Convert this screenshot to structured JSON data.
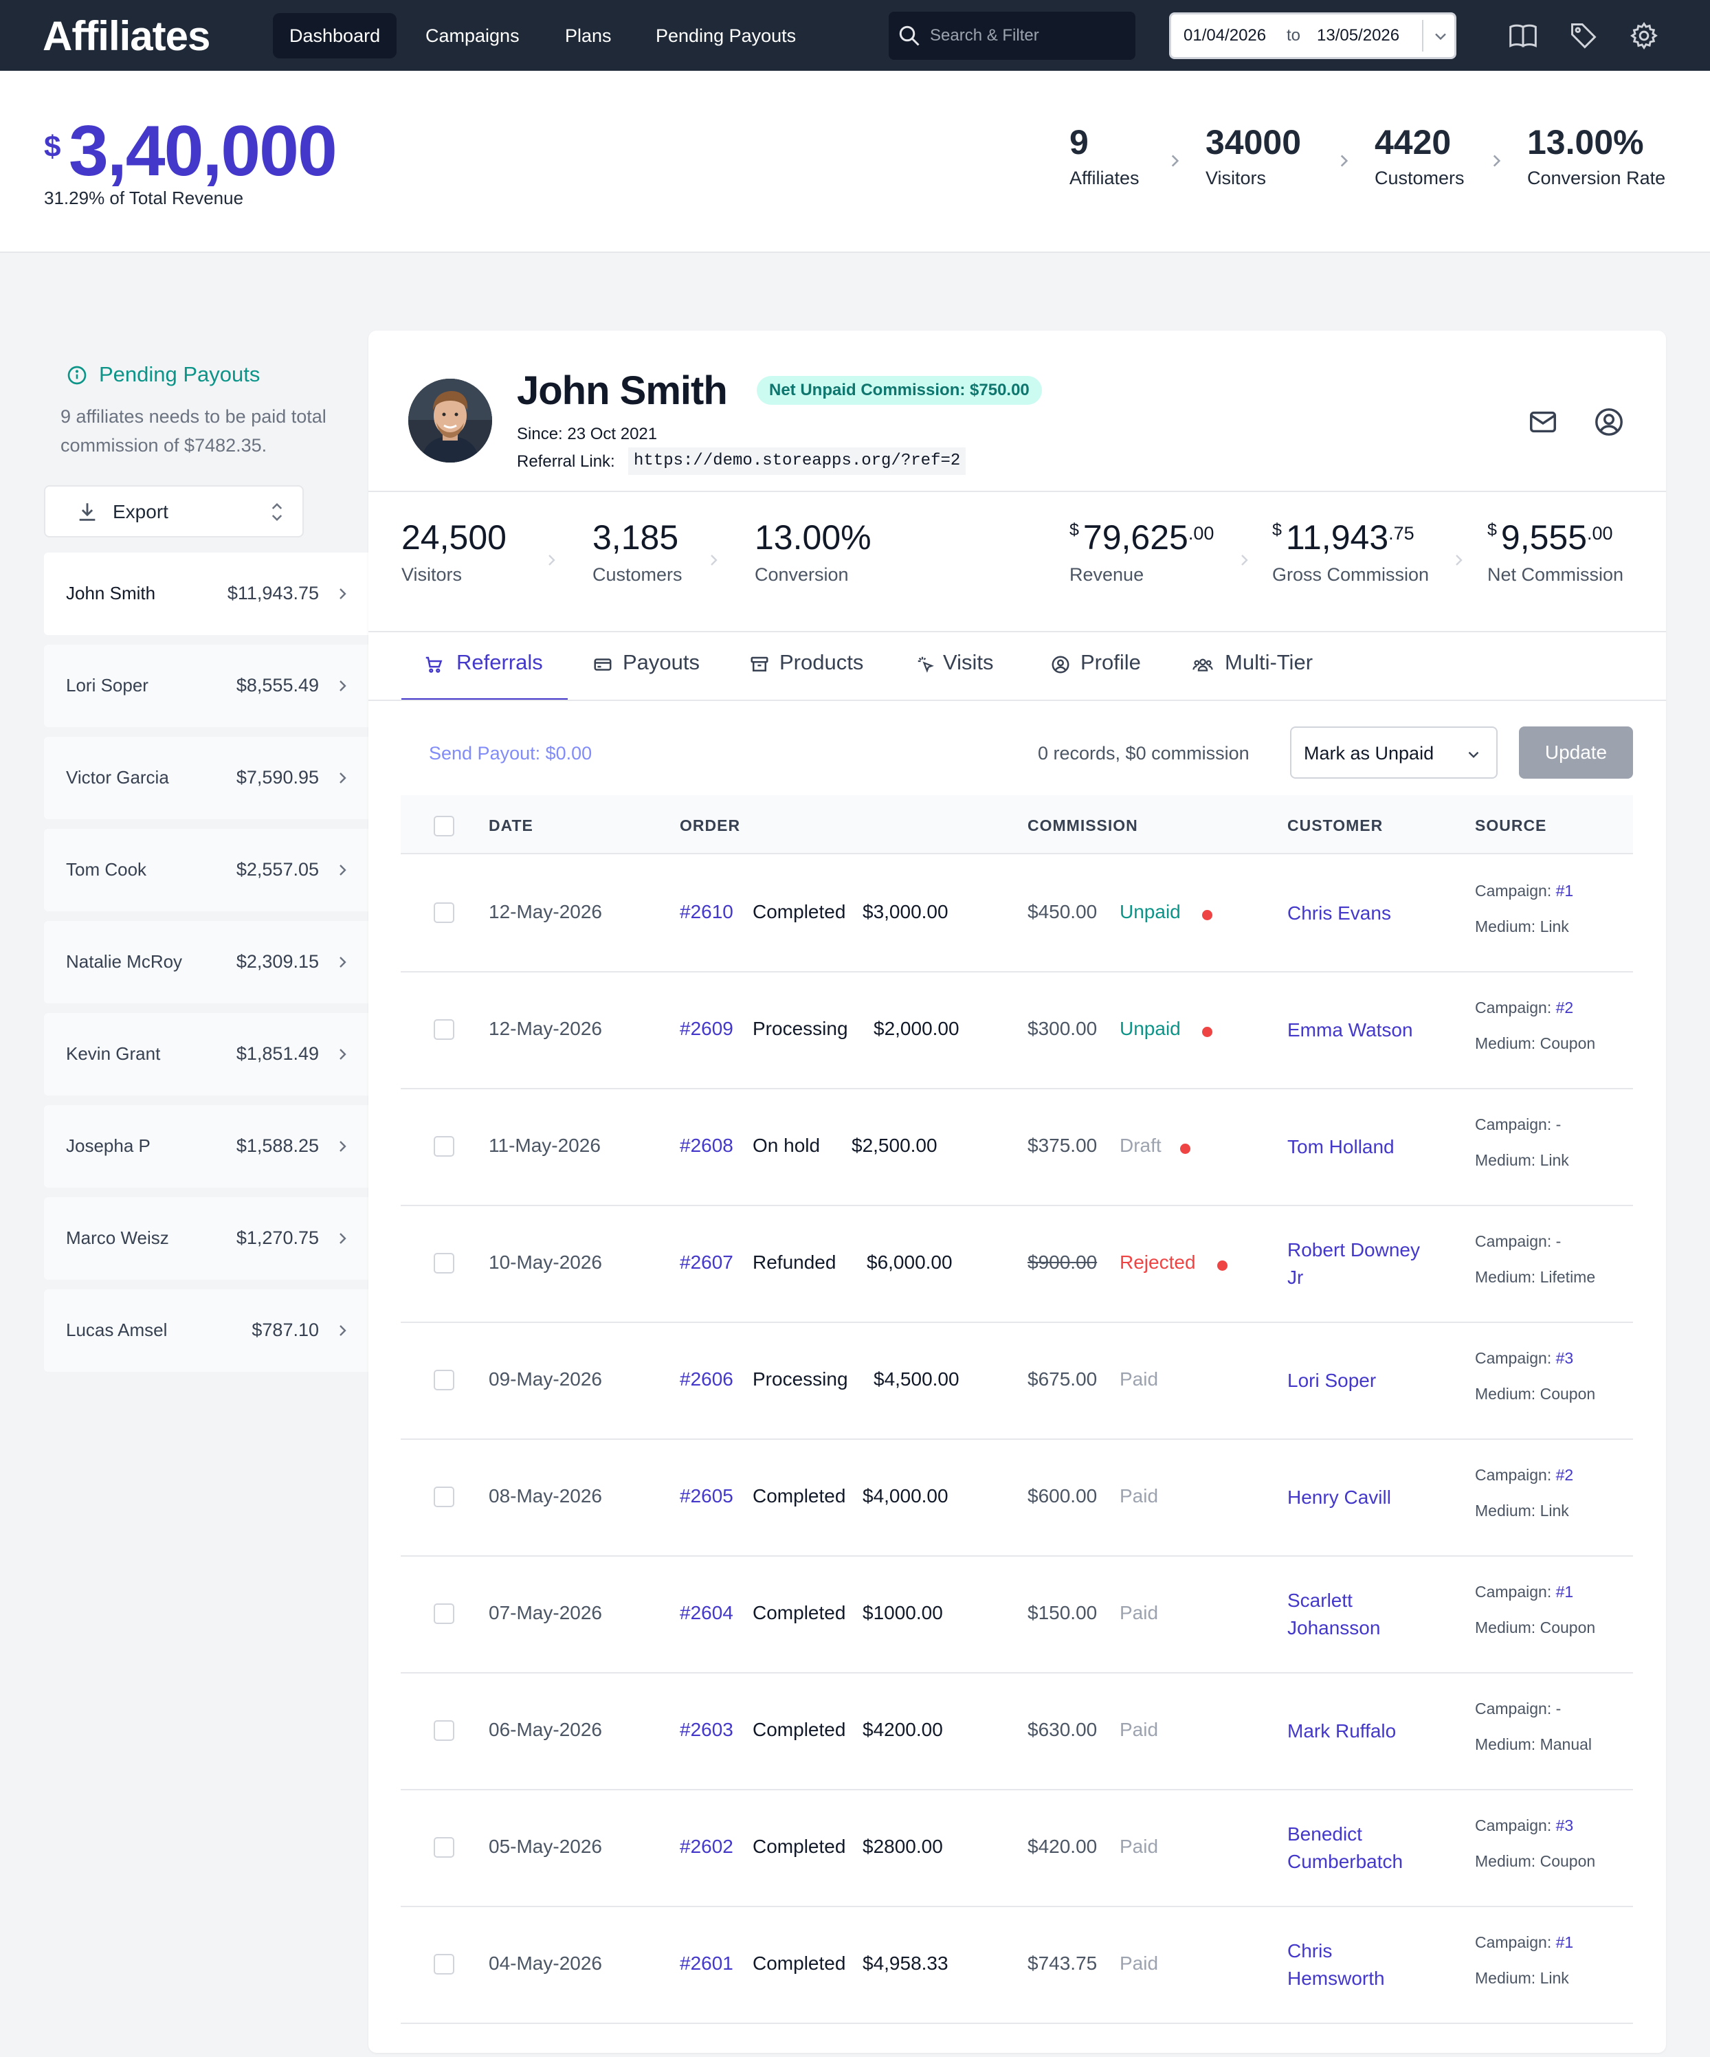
{
  "nav": {
    "brand": "Affiliates",
    "items": [
      {
        "label": "Dashboard",
        "active": true
      },
      {
        "label": "Campaigns",
        "active": false
      },
      {
        "label": "Plans",
        "active": false
      },
      {
        "label": "Pending Payouts",
        "active": false
      }
    ],
    "search_placeholder": "Search & Filter",
    "date_from": "01/04/2026",
    "date_to_label": "to",
    "date_to": "13/05/2026",
    "icons": [
      "book-icon",
      "tag-icon",
      "gear-icon"
    ]
  },
  "hero": {
    "currency": "$",
    "total": "3,40,000",
    "subtitle": "31.29% of Total Revenue",
    "stats": [
      {
        "value": "9",
        "label": "Affiliates"
      },
      {
        "value": "34000",
        "label": "Visitors"
      },
      {
        "value": "4420",
        "label": "Customers"
      },
      {
        "value": "13.00%",
        "label": "Conversion Rate"
      }
    ]
  },
  "sidebar": {
    "title": "Pending Payouts",
    "description": "9 affiliates needs to be paid total commission of $7482.35.",
    "export_label": "Export",
    "affiliates": [
      {
        "name": "John Smith",
        "amount": "$11,943.75"
      },
      {
        "name": "Lori Soper",
        "amount": "$8,555.49"
      },
      {
        "name": "Victor Garcia",
        "amount": "$7,590.95"
      },
      {
        "name": "Tom Cook",
        "amount": "$2,557.05"
      },
      {
        "name": "Natalie McRoy",
        "amount": "$2,309.15"
      },
      {
        "name": "Kevin Grant",
        "amount": "$1,851.49"
      },
      {
        "name": "Josepha P",
        "amount": "$1,588.25"
      },
      {
        "name": "Marco Weisz",
        "amount": "$1,270.75"
      },
      {
        "name": "Lucas Amsel",
        "amount": "$787.10"
      }
    ]
  },
  "profile": {
    "name": "John Smith",
    "badge": "Net Unpaid Commission: $750.00",
    "since": "Since: 23 Oct 2021",
    "referral_label": "Referral Link:",
    "referral_link": "https://demo.storeapps.org/?ref=2"
  },
  "kpis": {
    "visitors": {
      "value": "24,500",
      "label": "Visitors"
    },
    "customers": {
      "value": "3,185",
      "label": "Customers"
    },
    "conversion": {
      "value": "13.00%",
      "label": "Conversion"
    },
    "revenue": {
      "currency": "$",
      "whole": "79,625",
      "decimal": ".00",
      "label": "Revenue"
    },
    "gross": {
      "currency": "$",
      "whole": "11,943",
      "decimal": ".75",
      "label": "Gross Commission"
    },
    "net": {
      "currency": "$",
      "whole": "9,555",
      "decimal": ".00",
      "label": "Net Commission"
    }
  },
  "tabs": [
    {
      "label": "Referrals",
      "icon": "cart-icon"
    },
    {
      "label": "Payouts",
      "icon": "card-icon"
    },
    {
      "label": "Products",
      "icon": "box-icon"
    },
    {
      "label": "Visits",
      "icon": "pointer-icon"
    },
    {
      "label": "Profile",
      "icon": "user-circle-icon"
    },
    {
      "label": "Multi-Tier",
      "icon": "users-icon"
    }
  ],
  "actions": {
    "send_payout": "Send Payout: $0.00",
    "records": "0 records, $0 commission",
    "mark_select": "Mark as Unpaid",
    "update": "Update"
  },
  "table": {
    "headers": {
      "date": "DATE",
      "order": "ORDER",
      "commission": "COMMISSION",
      "customer": "CUSTOMER",
      "source": "SOURCE"
    },
    "campaign_label": "Campaign:",
    "medium_label": "Medium:",
    "rows": [
      {
        "date": "12-May-2026",
        "order": "#2610",
        "status": "Completed",
        "total": "$3,000.00",
        "commission": "$450.00",
        "payout": "Unpaid",
        "customer": "Chris Evans",
        "campaign": "#1",
        "medium": "Link"
      },
      {
        "date": "12-May-2026",
        "order": "#2609",
        "status": "Processing",
        "total": "$2,000.00",
        "commission": "$300.00",
        "payout": "Unpaid",
        "customer": "Emma Watson",
        "campaign": "#2",
        "medium": "Coupon"
      },
      {
        "date": "11-May-2026",
        "order": "#2608",
        "status": "On hold",
        "total": "$2,500.00",
        "commission": "$375.00",
        "payout": "Draft",
        "customer": "Tom Holland",
        "campaign": "-",
        "medium": "Link"
      },
      {
        "date": "10-May-2026",
        "order": "#2607",
        "status": "Refunded",
        "total": "$6,000.00",
        "commission": "$900.00",
        "payout": "Rejected",
        "customer": "Robert Downey Jr",
        "campaign": "-",
        "medium": "Lifetime"
      },
      {
        "date": "09-May-2026",
        "order": "#2606",
        "status": "Processing",
        "total": "$4,500.00",
        "commission": "$675.00",
        "payout": "Paid",
        "customer": "Lori Soper",
        "campaign": "#3",
        "medium": "Coupon"
      },
      {
        "date": "08-May-2026",
        "order": "#2605",
        "status": "Completed",
        "total": "$4,000.00",
        "commission": "$600.00",
        "payout": "Paid",
        "customer": "Henry Cavill",
        "campaign": "#2",
        "medium": "Link"
      },
      {
        "date": "07-May-2026",
        "order": "#2604",
        "status": "Completed",
        "total": "$1000.00",
        "commission": "$150.00",
        "payout": "Paid",
        "customer": "Scarlett Johansson",
        "campaign": "#1",
        "medium": "Coupon"
      },
      {
        "date": "06-May-2026",
        "order": "#2603",
        "status": "Completed",
        "total": "$4200.00",
        "commission": "$630.00",
        "payout": "Paid",
        "customer": "Mark Ruffalo",
        "campaign": "-",
        "medium": "Manual"
      },
      {
        "date": "05-May-2026",
        "order": "#2602",
        "status": "Completed",
        "total": "$2800.00",
        "commission": "$420.00",
        "payout": "Paid",
        "customer": "Benedict Cumberbatch",
        "campaign": "#3",
        "medium": "Coupon"
      },
      {
        "date": "04-May-2026",
        "order": "#2601",
        "status": "Completed",
        "total": "$4,958.33",
        "commission": "$743.75",
        "payout": "Paid",
        "customer": "Chris Hemsworth",
        "campaign": "#1",
        "medium": "Link"
      }
    ]
  },
  "colors": {
    "brand_indigo": "#4338ca",
    "teal": "#0d9488",
    "nav_bg": "#1f2937",
    "danger": "#ef4444"
  }
}
